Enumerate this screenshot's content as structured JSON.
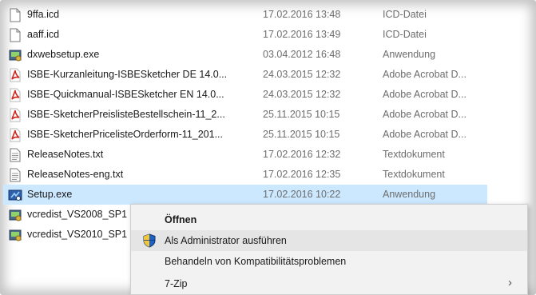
{
  "files": [
    {
      "name": "9ffa.icd",
      "date": "17.02.2016 13:48",
      "type": "ICD-Datei",
      "icon": "generic-file-icon"
    },
    {
      "name": "aaff.icd",
      "date": "17.02.2016 13:49",
      "type": "ICD-Datei",
      "icon": "generic-file-icon"
    },
    {
      "name": "dxwebsetup.exe",
      "date": "03.04.2012 16:48",
      "type": "Anwendung",
      "icon": "installer-icon"
    },
    {
      "name": "ISBE-Kurzanleitung-ISBESketcher DE 14.0...",
      "date": "24.03.2015 12:32",
      "type": "Adobe Acrobat D...",
      "icon": "pdf-icon"
    },
    {
      "name": "ISBE-Quickmanual-ISBESketcher EN 14.0...",
      "date": "24.03.2015 12:32",
      "type": "Adobe Acrobat D...",
      "icon": "pdf-icon"
    },
    {
      "name": "ISBE-SketcherPreislisteBestellschein-11_2...",
      "date": "25.11.2015 10:15",
      "type": "Adobe Acrobat D...",
      "icon": "pdf-icon"
    },
    {
      "name": "ISBE-SketcherPricelisteOrderform-11_201...",
      "date": "25.11.2015 10:15",
      "type": "Adobe Acrobat D...",
      "icon": "pdf-icon"
    },
    {
      "name": "ReleaseNotes.txt",
      "date": "17.02.2016 12:32",
      "type": "Textdokument",
      "icon": "text-file-icon"
    },
    {
      "name": "ReleaseNotes-eng.txt",
      "date": "17.02.2016 12:35",
      "type": "Textdokument",
      "icon": "text-file-icon"
    },
    {
      "name": "Setup.exe",
      "date": "17.02.2016 10:22",
      "type": "Anwendung",
      "icon": "setup-icon"
    },
    {
      "name": "vcredist_VS2008_SP1",
      "date": "",
      "type": "",
      "icon": "installer-icon"
    },
    {
      "name": "vcredist_VS2010_SP1",
      "date": "",
      "type": "",
      "icon": "installer-icon"
    }
  ],
  "context_menu": {
    "open": "Öffnen",
    "run_as_admin": "Als Administrator ausführen",
    "compat": "Behandeln von Kompatibilitätsproblemen",
    "zip": "7-Zip",
    "zip_arrow": "›"
  },
  "colors": {
    "selection": "#cce8ff",
    "pdf_red": "#d0281e",
    "menu_bg": "#f2f2f2"
  }
}
